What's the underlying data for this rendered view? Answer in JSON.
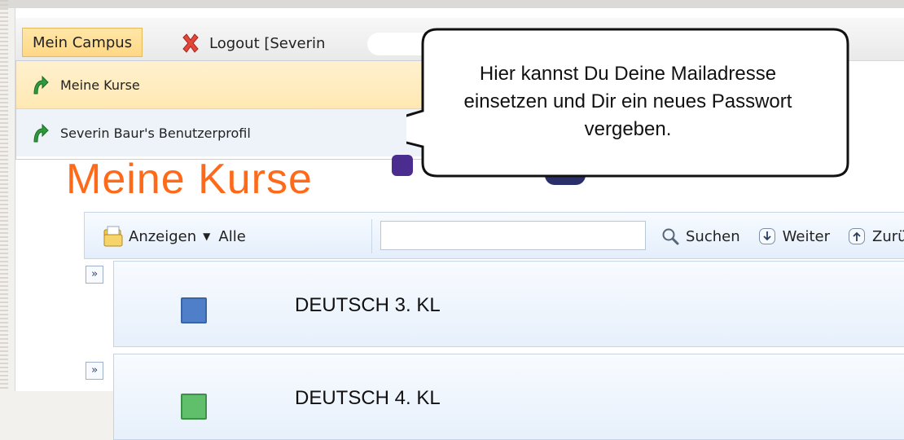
{
  "nav": {
    "campus_label": "Mein Campus",
    "logout_label": "Logout [Severin"
  },
  "menu": {
    "items": [
      {
        "label": "Meine Kurse"
      },
      {
        "label": "Severin Baur's Benutzerprofil"
      }
    ]
  },
  "callout": {
    "lines": [
      "Hier kannst Du Deine Mailadresse",
      "einsetzen und Dir ein neues Passwort",
      "vergeben."
    ]
  },
  "page": {
    "title": "Meine Kurse"
  },
  "toolbar": {
    "show_label": "Anzeigen",
    "filter_label": "Alle",
    "search_value": "",
    "search_label": "Suchen",
    "next_label": "Weiter",
    "back_label": "Zurü"
  },
  "courses": [
    {
      "name": "DEUTSCH 3. KL",
      "color": "#4f7fc8"
    },
    {
      "name": "DEUTSCH 4. KL",
      "color": "#5fbf6a"
    }
  ],
  "colors": {
    "title": "#ff6a1a",
    "accent": "#ffd886"
  },
  "icons": {
    "logout": "close-icon",
    "menu_item": "green-arrow-icon",
    "show": "folder-icon",
    "search": "magnifier-icon",
    "next": "arrow-down-icon",
    "back": "arrow-up-icon",
    "expander": "double-chevron-right-icon"
  }
}
